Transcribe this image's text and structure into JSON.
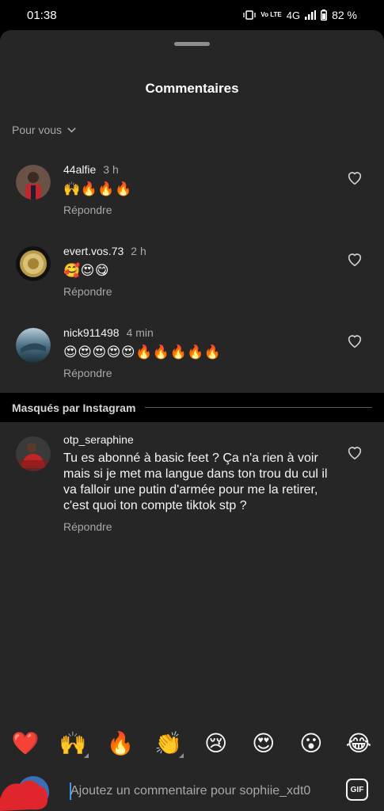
{
  "status": {
    "time": "01:38",
    "volte": "Vo LTE",
    "network": "4G",
    "battery": "82 %"
  },
  "sheet": {
    "title": "Commentaires",
    "filter": "Pour vous"
  },
  "comments": [
    {
      "user": "44alfie",
      "time": "3 h",
      "text": "🙌🔥🔥🔥",
      "reply": "Répondre"
    },
    {
      "user": "evert.vos.73",
      "time": "2 h",
      "text": "🥰😍😋",
      "reply": "Répondre"
    },
    {
      "user": "nick911498",
      "time": "4 min",
      "text": "😍😍😍😍😍🔥🔥🔥🔥🔥",
      "reply": "Répondre"
    }
  ],
  "hidden_section": {
    "label": "Masqués par Instagram",
    "comment": {
      "user": "otp_seraphine",
      "text": "Tu es abonné à basic feet ? Ça n'a rien à voir mais si je met ma langue dans ton trou du cul il va falloir une putin d'armée pour me la retirer, c'est quoi ton compte tiktok stp ?",
      "reply": "Répondre"
    }
  },
  "quick_reactions": [
    "❤️",
    "🙌",
    "🔥",
    "👏",
    "😢",
    "😍",
    "😮",
    "😂"
  ],
  "composer": {
    "placeholder": "Ajoutez un commentaire pour sophiie_xdt0",
    "gif_label": "GIF"
  }
}
